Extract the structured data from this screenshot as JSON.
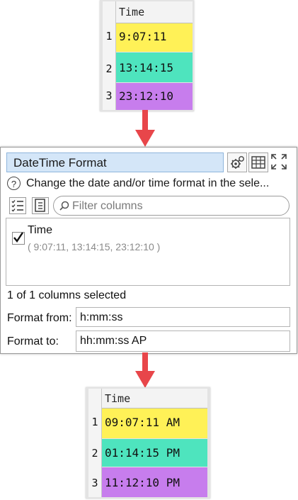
{
  "top_table": {
    "header": "Time",
    "rows": [
      {
        "num": "1",
        "value": "9:07:11",
        "color": "#fff157"
      },
      {
        "num": "2",
        "value": "13:14:15",
        "color": "#4ee4be"
      },
      {
        "num": "3",
        "value": "23:12:10",
        "color": "#c77ded"
      }
    ]
  },
  "panel": {
    "title": "DateTime Format",
    "help_icon": "?",
    "help_text": "Change the date and/or time format in the sele...",
    "filter_placeholder": "Filter columns",
    "columns": [
      {
        "name": "Time",
        "checked": true,
        "values": "( 9:07:11, 13:14:15, 23:12:10 )"
      }
    ],
    "selected_count": "1 of 1 columns selected",
    "format_from_label": "Format from:",
    "format_from_value": "h:mm:ss",
    "format_to_label": "Format to:",
    "format_to_value": "hh:mm:ss AP",
    "icons": [
      "settings-gears-icon",
      "table-view-icon",
      "maximize-icon",
      "select-all-icon",
      "deselect-icon",
      "search-icon",
      "checkmark-icon",
      "help-icon"
    ]
  },
  "bottom_table": {
    "header": "Time",
    "rows": [
      {
        "num": "1",
        "value": "09:07:11 AM",
        "color": "#fff157"
      },
      {
        "num": "2",
        "value": "01:14:15 PM",
        "color": "#4ee4be"
      },
      {
        "num": "3",
        "value": "11:12:10 PM",
        "color": "#c77ded"
      }
    ]
  },
  "colors": {
    "arrow": "#e8464a",
    "title_bg": "#d4e6f8"
  }
}
